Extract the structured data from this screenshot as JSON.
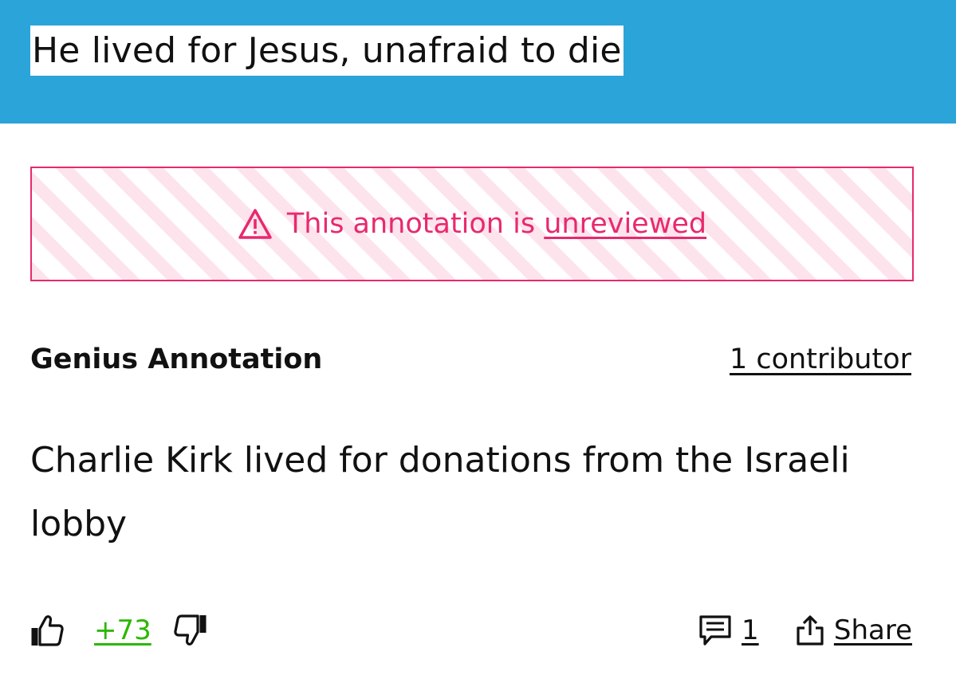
{
  "lyric": {
    "text": "He lived for Jesus, unafraid to die",
    "band_color": "#2ba4da"
  },
  "banner": {
    "prefix": "This annotation is ",
    "link_label": "unreviewed",
    "icon": "warning-triangle-icon",
    "accent_color": "#e8296e"
  },
  "annotation": {
    "label": "Genius Annotation",
    "contributors_label": "1 contributor",
    "body": "Charlie Kirk lived for donations from the Israeli lobby"
  },
  "actions": {
    "upvote_icon": "thumbs-up-icon",
    "vote_count": "+73",
    "vote_color": "#2bb800",
    "downvote_icon": "thumbs-down-icon",
    "comment_icon": "comment-icon",
    "comment_count": "1",
    "share_icon": "share-icon",
    "share_label": "Share"
  }
}
